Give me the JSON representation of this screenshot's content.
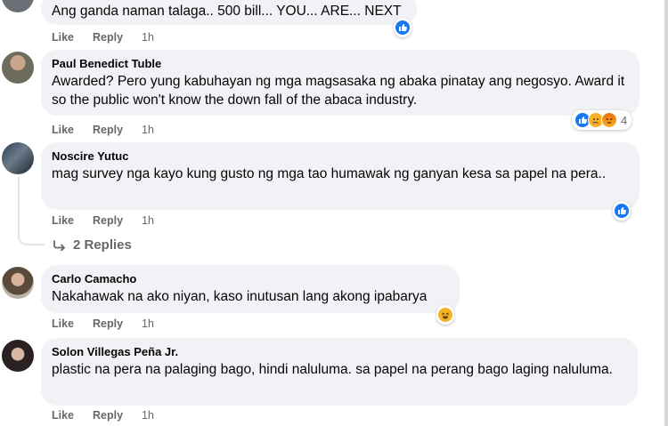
{
  "comments": [
    {
      "author": "",
      "text": "Ang ganda naman talaga.. 500 bill... YOU... ARE... NEXT",
      "like": "Like",
      "reply": "Reply",
      "time": "1h"
    },
    {
      "author": "Paul Benedict Tuble",
      "text": "Awarded? Pero yung kabuhayan ng mga magsasaka ng abaka pinatay ang negosyo. Award it so the public won't know the down fall of the abaca industry.",
      "like": "Like",
      "reply": "Reply",
      "time": "1h",
      "reaction_count": "4"
    },
    {
      "author": "Noscire Yutuc",
      "text": "mag survey nga kayo kung gusto ng mga tao humawak ng ganyan kesa sa papel na pera..",
      "like": "Like",
      "reply": "Reply",
      "time": "1h",
      "replies_label": "2 Replies"
    },
    {
      "author": "Carlo Camacho",
      "text": "Nakahawak na ako niyan, kaso inutusan lang akong ipabarya",
      "like": "Like",
      "reply": "Reply",
      "time": "1h"
    },
    {
      "author": "Solon Villegas Peña Jr.",
      "text": "plastic na pera na palaging bago, hindi naluluma. sa papel na perang bago laging naluluma.",
      "like": "Like",
      "reply": "Reply",
      "time": "1h"
    }
  ],
  "icons": {
    "like": "like-reaction-icon",
    "sad": "sad-reaction-icon",
    "angry": "angry-reaction-icon",
    "haha": "haha-reaction-icon",
    "reply_arrow": "reply-arrow-icon"
  },
  "colors": {
    "bubble": "#f0f2f5",
    "meta": "#65676b",
    "like_blue": "#1877f2"
  }
}
